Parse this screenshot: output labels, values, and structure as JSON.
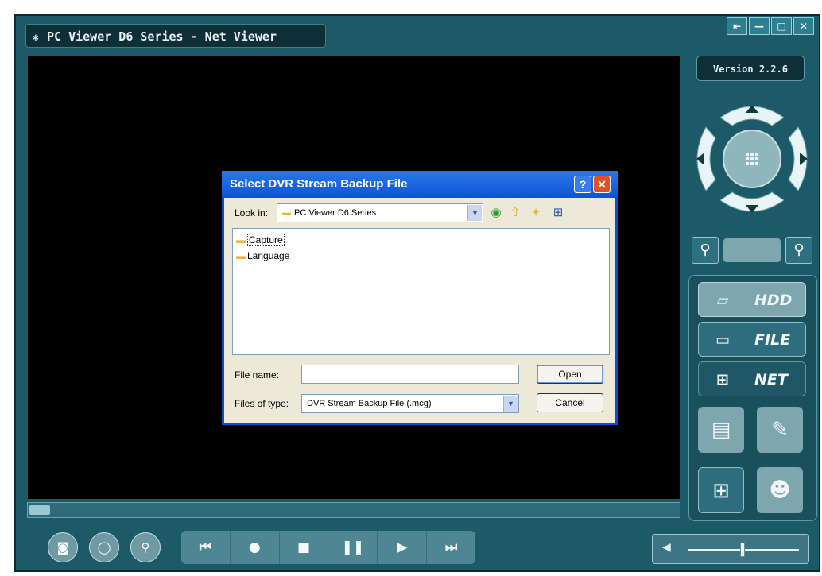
{
  "app": {
    "title": "PC Viewer D6 Series - Net Viewer",
    "version": "Version 2.2.6"
  },
  "side_menu": {
    "items": [
      {
        "label": "HDD",
        "icon": "hdd-icon"
      },
      {
        "label": "FILE",
        "icon": "folder-icon"
      },
      {
        "label": "NET",
        "icon": "network-icon"
      }
    ]
  },
  "playback": {
    "progress": 0,
    "volume": 0.5
  },
  "dialog": {
    "title": "Select DVR Stream Backup File",
    "look_in_label": "Look in:",
    "look_in_value": "PC Viewer D6 Series",
    "items": [
      "Capture",
      "Language"
    ],
    "file_name_label": "File name:",
    "file_name_value": "",
    "files_of_type_label": "Files of type:",
    "files_of_type_value": "DVR Stream Backup File (.mcg)",
    "open_label": "Open",
    "cancel_label": "Cancel"
  }
}
